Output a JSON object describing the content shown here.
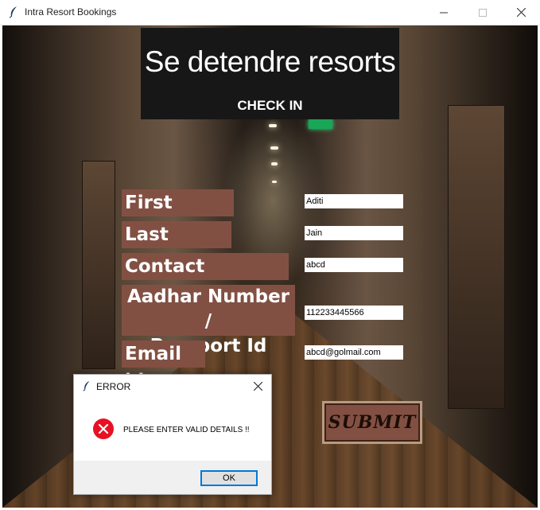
{
  "window": {
    "title": "Intra Resort Bookings"
  },
  "header": {
    "brand": "Se detendre resorts",
    "subtitle": "CHECK IN"
  },
  "form": {
    "labels": {
      "first_name": "First Name",
      "last_name": "Last Name",
      "contact_number": "Contact Number",
      "aadhar_line1": "Aadhar Number /",
      "aadhar_line2": "Passport Id",
      "email": "Email id"
    },
    "values": {
      "first_name": "Aditi",
      "last_name": "Jain",
      "contact_number": "abcd",
      "aadhar": "112233445566",
      "email": "abcd@golmail.com"
    },
    "submit_label": "SUBMIT"
  },
  "dialog": {
    "title": "ERROR",
    "message": "PLEASE ENTER VALID DETAILS !!",
    "ok_label": "OK"
  },
  "colors": {
    "label_bg": "#825043",
    "header_bg": "#171717",
    "error_red": "#e81123",
    "focus_blue": "#0078d7"
  },
  "icons": [
    "feather-icon",
    "minimize-icon",
    "maximize-icon",
    "close-icon",
    "error-icon"
  ]
}
